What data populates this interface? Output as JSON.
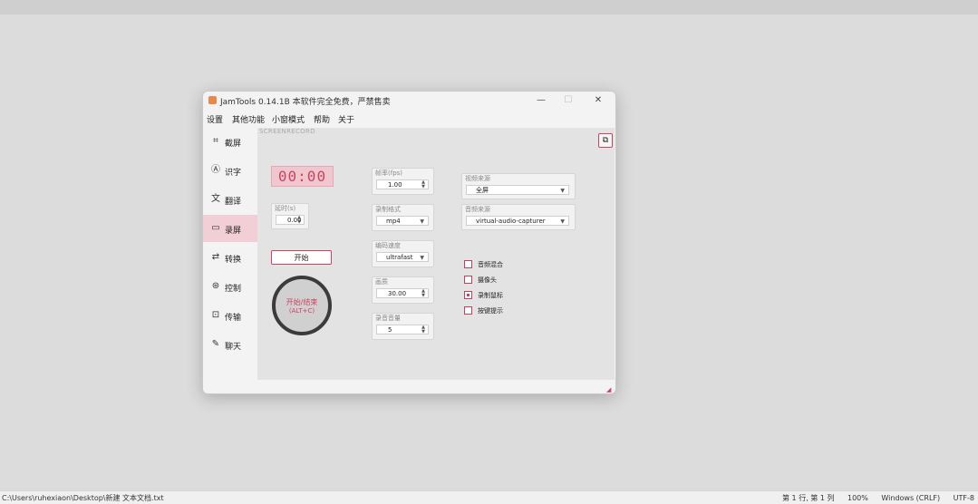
{
  "window": {
    "title": "JamTools 0.14.1B 本软件完全免费，严禁售卖",
    "min_glyph": "—",
    "max_glyph": "☐",
    "close_glyph": "✕"
  },
  "menu": [
    "设置",
    "其他功能",
    "小窗模式",
    "帮助",
    "关于"
  ],
  "sidebar": {
    "items": [
      {
        "label": "截屏",
        "icon": "screenshot-icon",
        "glyph": "⌗",
        "active": false
      },
      {
        "label": "识字",
        "icon": "ocr-icon",
        "glyph": "Ⓐ",
        "active": false
      },
      {
        "label": "翻译",
        "icon": "translate-icon",
        "glyph": "文",
        "active": false
      },
      {
        "label": "录屏",
        "icon": "record-icon",
        "glyph": "▭",
        "active": true
      },
      {
        "label": "转换",
        "icon": "convert-icon",
        "glyph": "⇄",
        "active": false
      },
      {
        "label": "控制",
        "icon": "control-icon",
        "glyph": "⊛",
        "active": false
      },
      {
        "label": "传输",
        "icon": "transfer-icon",
        "glyph": "⊡",
        "active": false
      },
      {
        "label": "聊天",
        "icon": "chat-icon",
        "glyph": "✎",
        "active": false
      }
    ]
  },
  "main": {
    "section_label": "SCREENRECORD",
    "corner_glyph": "⧉",
    "timer": "00:00",
    "delay": {
      "label": "延时(s)",
      "value": "0.00"
    },
    "start_button": "开始",
    "record_button": {
      "line1": "开始/结束",
      "line2": "(ALT+C)"
    },
    "framerate": {
      "label": "帧率(fps)",
      "value": "1.00"
    },
    "format": {
      "label": "录制格式",
      "value": "mp4"
    },
    "encoding": {
      "label": "编码速度",
      "value": "ultrafast"
    },
    "quality": {
      "label": "画质",
      "value": "30.00"
    },
    "volume": {
      "label": "录音音量",
      "value": "5"
    },
    "video_source": {
      "label": "视频来源",
      "value": "全屏"
    },
    "audio_source": {
      "label": "音频来源",
      "value": "virtual-audio-capturer"
    },
    "checkboxes": [
      {
        "label": "音频混合",
        "checked": false
      },
      {
        "label": "摄像头",
        "checked": false
      },
      {
        "label": "录制鼠标",
        "checked": true
      },
      {
        "label": "按键提示",
        "checked": false
      }
    ]
  },
  "statusbar": {
    "path": "C:\\Users\\ruhexiaon\\Desktop\\新建 文本文档.txt",
    "position": "第 1 行, 第 1 列",
    "zoom": "100%",
    "line_ending": "Windows (CRLF)",
    "encoding": "UTF-8"
  },
  "colors": {
    "accent": "#d04060",
    "active_bg": "#f2cfd6"
  }
}
